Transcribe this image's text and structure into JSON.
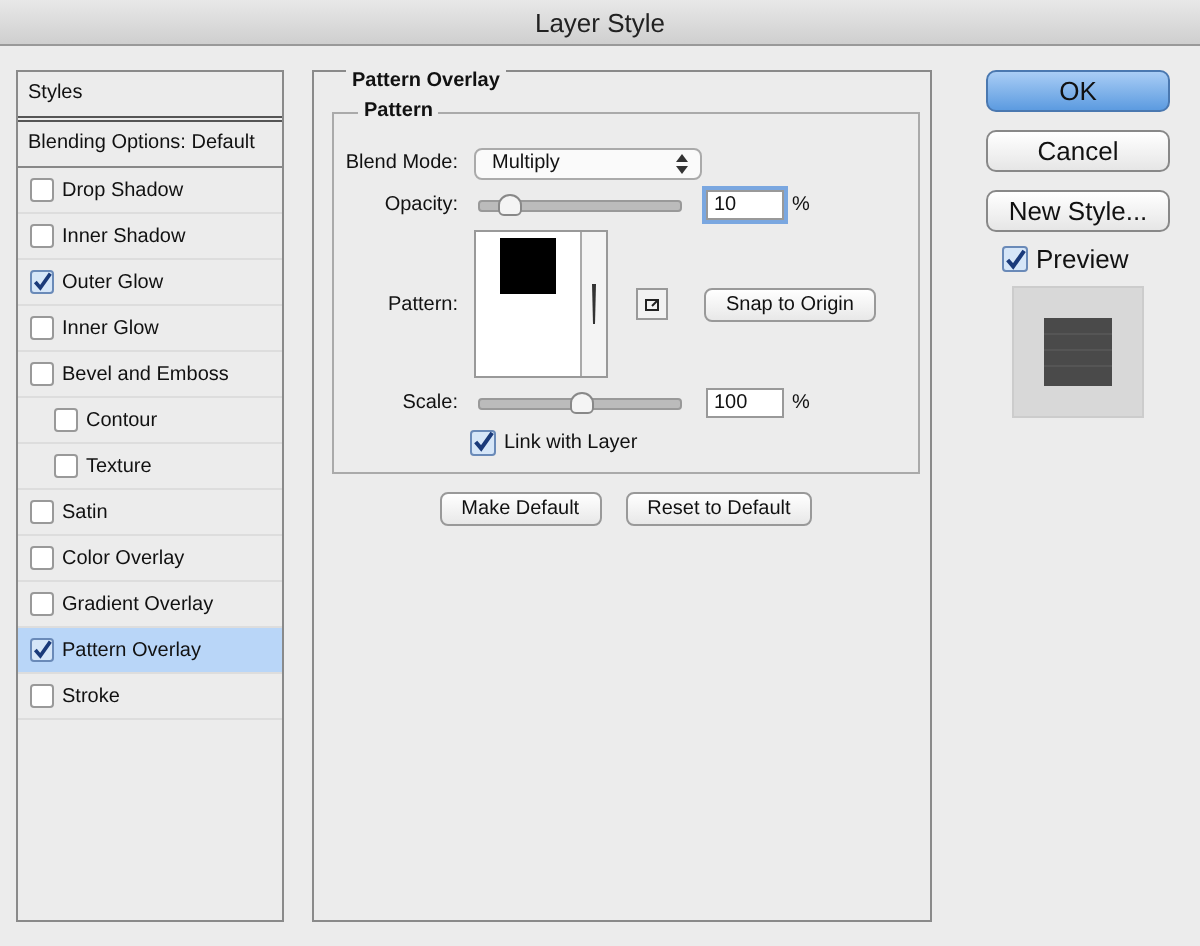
{
  "window": {
    "title": "Layer Style"
  },
  "sidebar": {
    "header": "Styles",
    "blending": "Blending Options: Default",
    "items": [
      {
        "label": "Drop Shadow",
        "checked": false,
        "selected": false
      },
      {
        "label": "Inner Shadow",
        "checked": false,
        "selected": false
      },
      {
        "label": "Outer Glow",
        "checked": true,
        "selected": false
      },
      {
        "label": "Inner Glow",
        "checked": false,
        "selected": false
      },
      {
        "label": "Bevel and Emboss",
        "checked": false,
        "selected": false,
        "children": [
          {
            "label": "Contour",
            "checked": false,
            "selected": false
          },
          {
            "label": "Texture",
            "checked": false,
            "selected": false
          }
        ]
      },
      {
        "label": "Satin",
        "checked": false,
        "selected": false
      },
      {
        "label": "Color Overlay",
        "checked": false,
        "selected": false
      },
      {
        "label": "Gradient Overlay",
        "checked": false,
        "selected": false
      },
      {
        "label": "Pattern Overlay",
        "checked": true,
        "selected": true
      },
      {
        "label": "Stroke",
        "checked": false,
        "selected": false
      }
    ]
  },
  "panel": {
    "title": "Pattern Overlay",
    "group": "Pattern",
    "blend_mode": {
      "label": "Blend Mode:",
      "value": "Multiply"
    },
    "opacity": {
      "label": "Opacity:",
      "level": 0.1,
      "value": "10",
      "unit": "%"
    },
    "pattern": {
      "label": "Pattern:",
      "snap_button": "Snap to Origin"
    },
    "scale": {
      "label": "Scale:",
      "level": 0.5,
      "value": "100",
      "unit": "%"
    },
    "link": {
      "label": "Link with Layer",
      "checked": true
    },
    "buttons": [
      "Make Default",
      "Reset to Default"
    ]
  },
  "actions": {
    "ok": "OK",
    "cancel": "Cancel",
    "new_style": "New Style...",
    "preview": {
      "label": "Preview",
      "checked": true
    }
  }
}
